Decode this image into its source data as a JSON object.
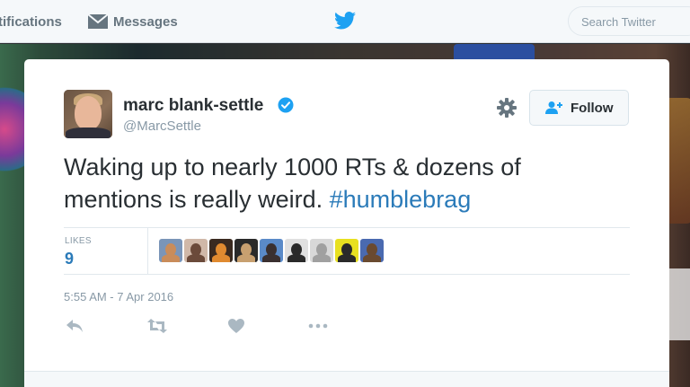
{
  "nav": {
    "notifications_label": "tifications",
    "messages_label": "Messages",
    "search_placeholder": "Search Twitter",
    "logo_icon": "twitter-bird-icon"
  },
  "tweet": {
    "author": {
      "display_name": "marc blank-settle",
      "handle": "@MarcSettle",
      "verified": true
    },
    "follow_label": "Follow",
    "text_main": "Waking up to nearly 1000 RTs & dozens of mentions is really weird. ",
    "hashtag": "#humblebrag",
    "likes_label": "LIKES",
    "likes_count": "9",
    "timestamp": "5:55 AM - 7 Apr 2016",
    "likers": [
      {
        "name": "liker-1",
        "colors": [
          "#c98c5a",
          "#7a95b8"
        ]
      },
      {
        "name": "liker-2",
        "colors": [
          "#6b4a3a",
          "#d0b8a8"
        ]
      },
      {
        "name": "liker-3",
        "colors": [
          "#e08a30",
          "#3a2a20"
        ]
      },
      {
        "name": "liker-4",
        "colors": [
          "#c8a070",
          "#2a2a2a"
        ]
      },
      {
        "name": "liker-5",
        "colors": [
          "#3a3030",
          "#5a8ac8"
        ]
      },
      {
        "name": "liker-6",
        "colors": [
          "#2a2a2a",
          "#e0e0e0"
        ]
      },
      {
        "name": "liker-7",
        "colors": [
          "#a0a0a0",
          "#d8d8d8"
        ]
      },
      {
        "name": "liker-8",
        "colors": [
          "#2a2a2a",
          "#e8e020"
        ]
      },
      {
        "name": "liker-9",
        "colors": [
          "#6a4a30",
          "#4a6ab0"
        ]
      }
    ]
  },
  "colors": {
    "link_blue": "#2b7bb9",
    "text_dark": "#292f33",
    "text_muted": "#8899a6",
    "verified_blue": "#1da1f2"
  }
}
